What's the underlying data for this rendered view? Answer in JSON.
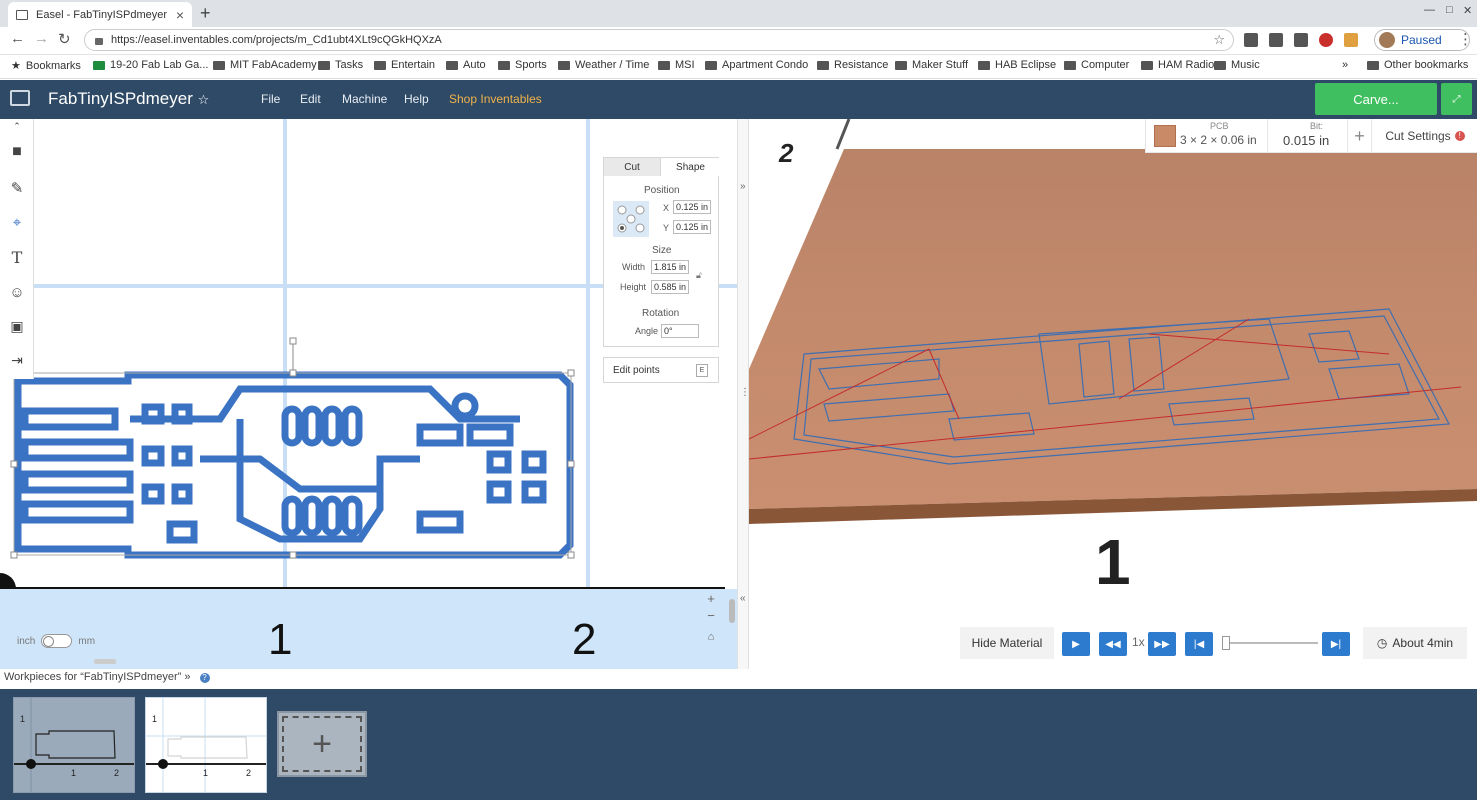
{
  "browser": {
    "tab_title": "Easel - FabTinyISPdmeyer",
    "url": "https://easel.inventables.com/projects/m_Cd1ubt4XLt9cQGkHQXzA",
    "profile_status": "Paused",
    "bookmarks_label": "Bookmarks",
    "bookmarks": [
      "19-20 Fab Lab Ga...",
      "MIT FabAcademy",
      "Tasks",
      "Entertain",
      "Auto",
      "Sports",
      "Weather / Time",
      "MSI",
      "Apartment Condo",
      "Resistance",
      "Maker Stuff",
      "HAB Eclipse",
      "Computer",
      "HAM Radio",
      "Music"
    ],
    "more_bookmarks": "»",
    "other_bookmarks": "Other bookmarks"
  },
  "app": {
    "project_title": "FabTinyISPdmeyer",
    "star": "☆",
    "menu": {
      "file": "File",
      "edit": "Edit",
      "machine": "Machine",
      "help": "Help",
      "shop": "Shop Inventables"
    },
    "carve_label": "Carve...",
    "accent": "#3fbf5f",
    "header_color": "#2f4a66"
  },
  "inspector": {
    "tab_cut": "Cut",
    "tab_shape": "Shape",
    "position_label": "Position",
    "x_label": "X",
    "x_value": "0.125 in",
    "y_label": "Y",
    "y_value": "0.125 in",
    "size_label": "Size",
    "width_label": "Width",
    "width_value": "1.815 in",
    "height_label": "Height",
    "height_value": "0.585 in",
    "rotation_label": "Rotation",
    "angle_label": "Angle",
    "angle_value": "0°",
    "edit_points": "Edit points",
    "edit_key": "E"
  },
  "canvas": {
    "ruler_1": "1",
    "ruler_2": "2",
    "unit_inch": "inch",
    "unit_mm": "mm",
    "zoom_in": "+",
    "zoom_out": "−",
    "home": "⌂"
  },
  "preview": {
    "material_type": "PCB",
    "material_dims": "3 × 2 × 0.06 in",
    "bit_label": "Bit:",
    "bit_value": "0.015 in",
    "add": "+",
    "cut_settings": "Cut Settings",
    "warning": "!",
    "axis_1": "1",
    "axis_2": "2",
    "hide_material": "Hide Material",
    "speed": "1x",
    "time_estimate": "About 4min"
  },
  "workpieces": {
    "label": "Workpieces for “FabTinyISPdmeyer”",
    "chevron": "»",
    "help": "?",
    "thumb_labels": [
      "1",
      "1",
      "2"
    ],
    "add": "+"
  }
}
